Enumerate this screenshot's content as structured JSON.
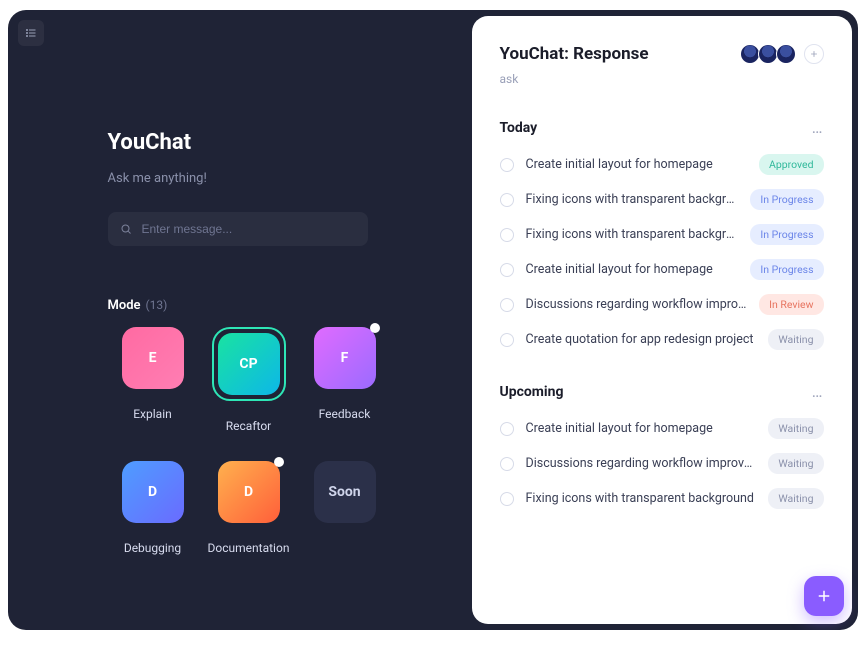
{
  "app_title": "YouChat",
  "subtitle": "Ask me anything!",
  "search_placeholder": "Enter message...",
  "mode": {
    "label": "Mode",
    "count": "(13)"
  },
  "cards": [
    {
      "initial": "E",
      "label": "Explain",
      "gradient": "g-pink",
      "selected": false,
      "dot": false
    },
    {
      "initial": "CP",
      "label": "Recaftor",
      "gradient": "g-green",
      "selected": true,
      "dot": false
    },
    {
      "initial": "F",
      "label": "Feedback",
      "gradient": "g-purple",
      "selected": false,
      "dot": true
    },
    {
      "initial": "D",
      "label": "Debugging",
      "gradient": "g-blue",
      "selected": false,
      "dot": false
    },
    {
      "initial": "D",
      "label": "Documentation",
      "gradient": "g-orange",
      "selected": false,
      "dot": true
    },
    {
      "initial": "Soon",
      "label": "",
      "gradient": "g-dark",
      "selected": false,
      "dot": false
    }
  ],
  "response": {
    "title": "YouChat: Response",
    "subtitle": "ask"
  },
  "sections": [
    {
      "title": "Today",
      "tasks": [
        {
          "title": "Create initial layout for homepage",
          "status": "Approved",
          "badge_class": "b-approved"
        },
        {
          "title": "Fixing icons with transparent background",
          "status": "In Progress",
          "badge_class": "b-inprogress"
        },
        {
          "title": "Fixing icons with transparent background",
          "status": "In Progress",
          "badge_class": "b-inprogress"
        },
        {
          "title": "Create initial layout for homepage",
          "status": "In Progress",
          "badge_class": "b-inprogress"
        },
        {
          "title": "Discussions regarding workflow improvement",
          "status": "In Review",
          "badge_class": "b-inreview"
        },
        {
          "title": "Create quotation for app redesign project",
          "status": "Waiting",
          "badge_class": "b-waiting"
        }
      ]
    },
    {
      "title": "Upcoming",
      "tasks": [
        {
          "title": "Create initial layout for homepage",
          "status": "Waiting",
          "badge_class": "b-waiting"
        },
        {
          "title": "Discussions regarding workflow improvement",
          "status": "Waiting",
          "badge_class": "b-waiting"
        },
        {
          "title": "Fixing icons with transparent background",
          "status": "Waiting",
          "badge_class": "b-waiting"
        }
      ]
    }
  ]
}
